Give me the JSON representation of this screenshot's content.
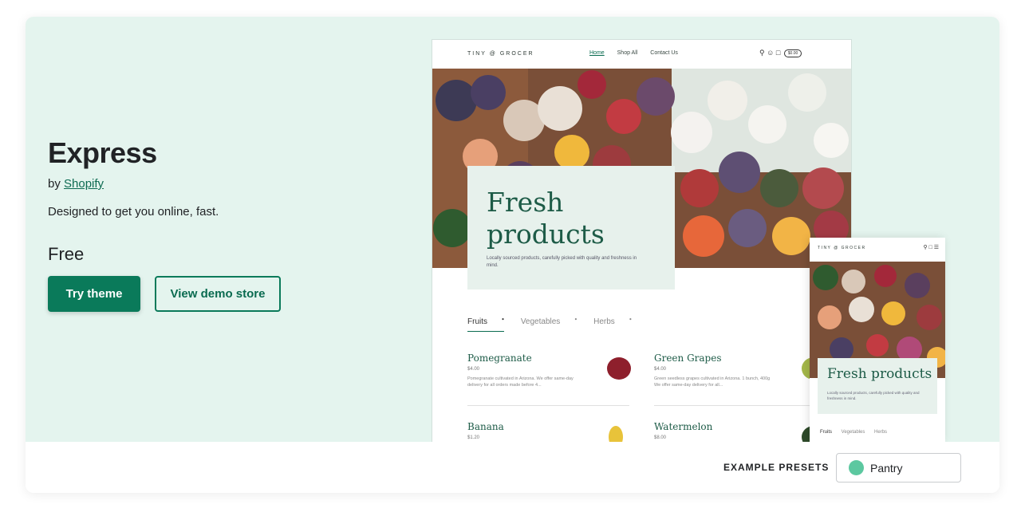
{
  "theme": {
    "title": "Express",
    "by_prefix": "by",
    "author": "Shopify",
    "description": "Designed to get you online, fast.",
    "price": "Free",
    "try_button": "Try theme",
    "demo_button": "View demo store"
  },
  "desktop_preview": {
    "logo": "TINY @ GROCER",
    "nav": [
      "Home",
      "Shop All",
      "Contact Us"
    ],
    "cart_amount": "$0.00",
    "hero_title": "Fresh products",
    "hero_subtitle": "Locally sourced products, carefully picked with quality and freshness in mind.",
    "tabs": [
      "Fruits",
      "Vegetables",
      "Herbs"
    ],
    "products": [
      {
        "name": "Pomegranate",
        "price": "$4.00",
        "desc": "Pomegranate cultivated in Arizona. We offer same-day delivery for all orders made before 4..."
      },
      {
        "name": "Green Grapes",
        "price": "$4.00",
        "desc": "Green seedless grapes cultivated in Arizona. 1 bunch, 400g We offer same-day delivery for all..."
      },
      {
        "name": "Banana",
        "price": "$1.20",
        "desc": ""
      },
      {
        "name": "Watermelon",
        "price": "$8.00",
        "desc": ""
      }
    ]
  },
  "mobile_preview": {
    "logo": "TINY @ GROCER",
    "hero_title": "Fresh products",
    "hero_subtitle": "Locally sourced products, carefully picked with quality and freshness in mind.",
    "tabs": [
      "Fruits",
      "Vegetables",
      "Herbs"
    ]
  },
  "presets": {
    "label": "EXAMPLE PRESETS",
    "selected": "Pantry",
    "selected_color": "#5cc8a0"
  },
  "colors": {
    "hero_bg": "#e4f4ee",
    "primary": "#0a7a5a",
    "heading_green": "#1d5b47"
  }
}
